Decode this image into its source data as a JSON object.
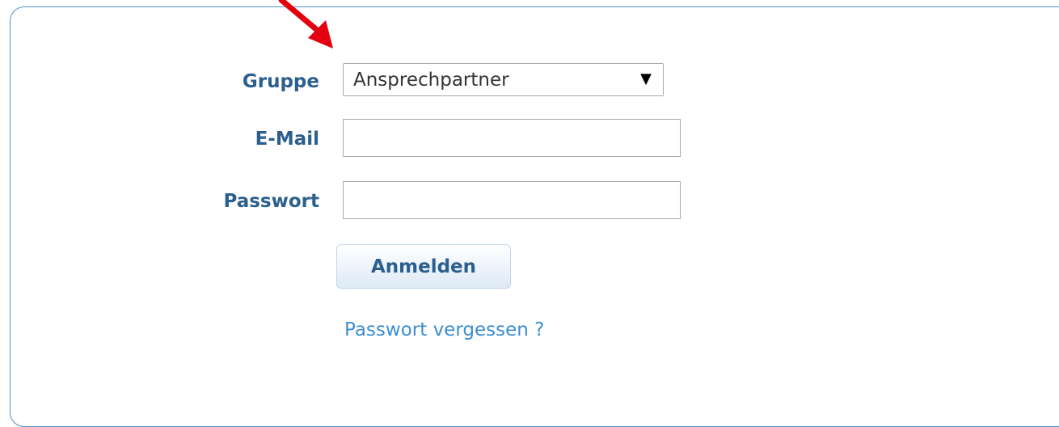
{
  "form": {
    "group_label": "Gruppe",
    "group_selected": "Ansprechpartner",
    "email_label": "E-Mail",
    "email_value": "",
    "password_label": "Passwort",
    "password_value": "",
    "login_button": "Anmelden",
    "forgot_link": "Passwort vergessen ?"
  },
  "icons": {
    "dropdown": "triangle-down-icon",
    "annotation": "red-arrow-icon"
  },
  "colors": {
    "label": "#2c5f8d",
    "link": "#3d8ecf",
    "border": "#4f93c9",
    "annotation_arrow": "#e3000f"
  }
}
